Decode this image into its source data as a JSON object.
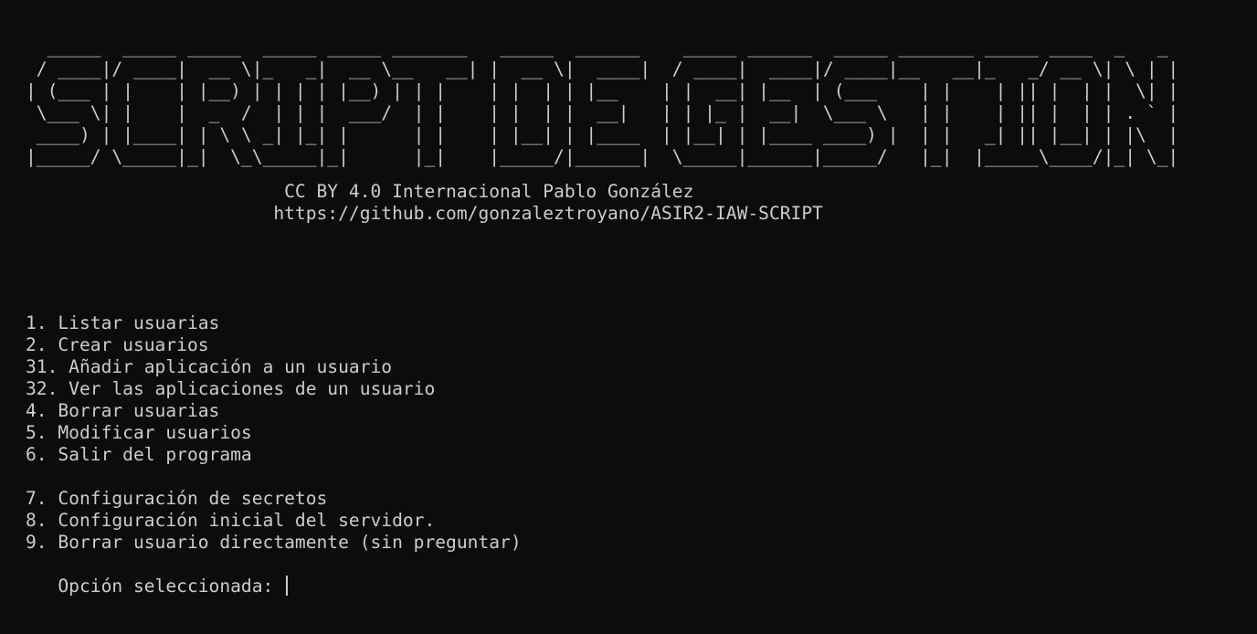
{
  "banner": {
    "art": "  _____  _____ _____  _____ _____ _______   _____  ______    _____ ______  _____ _______ _____ ____  _   _ \n / ____|/ ____|  __ \\|_   _|  __ \\__   __| |  __ \\|  ____|  / ____|  ____|/ ____|__   __|_   _/ __ \\| \\ | |\n| (___ | |    | |__) | | | | |__) | | |    | |  | | |__    | |  __| |__  | (___    | |    | || |  | |  \\| |\n \\___ \\| |    |  _  /  | | |  ___/  | |    | |  | |  __|   | | |_ |  __|  \\___ \\   | |    | || |  | | . ` |\n ____) | |____| | \\ \\ _| |_| |      | |    | |__| | |____  | |__| | |____ ____) |  | |   _| || |__| | |\\  |\n|_____/ \\_____|_|  \\_\\_____|_|      |_|    |_____/|______|  \\_____|______|_____/   |_|  |_____\\____/|_| \\_|"
  },
  "credits": {
    "license": "                        CC BY 4.0 Internacional Pablo González",
    "repo": "                       https://github.com/gonzaleztroyano/ASIR2-IAW-SCRIPT"
  },
  "menu": {
    "items": [
      "1. Listar usuarias",
      "2. Crear usuarios",
      "31. Añadir aplicación a un usuario",
      "32. Ver las aplicaciones de un usuario",
      "4. Borrar usuarias",
      "5. Modificar usuarios",
      "6. Salir del programa",
      "7. Configuración de secretos",
      "8. Configuración inicial del servidor.",
      "9. Borrar usuario directamente (sin preguntar)"
    ]
  },
  "prompt": {
    "label": "   Opción seleccionada: "
  }
}
